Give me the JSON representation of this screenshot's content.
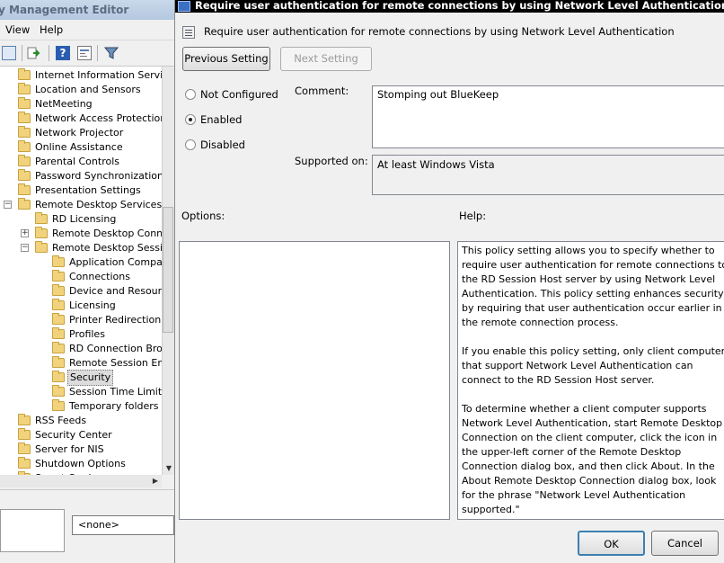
{
  "left_window": {
    "title": "y Management Editor",
    "menu": [
      "View",
      "Help"
    ],
    "tree": [
      {
        "label": "Internet Information Services",
        "level": 1
      },
      {
        "label": "Location and Sensors",
        "level": 1
      },
      {
        "label": "NetMeeting",
        "level": 1
      },
      {
        "label": "Network Access Protection",
        "level": 1
      },
      {
        "label": "Network Projector",
        "level": 1
      },
      {
        "label": "Online Assistance",
        "level": 1
      },
      {
        "label": "Parental Controls",
        "level": 1
      },
      {
        "label": "Password Synchronization",
        "level": 1
      },
      {
        "label": "Presentation Settings",
        "level": 1
      },
      {
        "label": "Remote Desktop Services",
        "level": 1,
        "expander": "−"
      },
      {
        "label": "RD Licensing",
        "level": 2
      },
      {
        "label": "Remote Desktop Connect",
        "level": 2,
        "expander": "+"
      },
      {
        "label": "Remote Desktop Session",
        "level": 2,
        "expander": "−"
      },
      {
        "label": "Application Compatibi",
        "level": 3
      },
      {
        "label": "Connections",
        "level": 3
      },
      {
        "label": "Device and Resource",
        "level": 3
      },
      {
        "label": "Licensing",
        "level": 3
      },
      {
        "label": "Printer Redirection",
        "level": 3
      },
      {
        "label": "Profiles",
        "level": 3
      },
      {
        "label": "RD Connection Broke",
        "level": 3
      },
      {
        "label": "Remote Session Envir",
        "level": 3
      },
      {
        "label": "Security",
        "level": 3,
        "selected": true
      },
      {
        "label": "Session Time Limits",
        "level": 3
      },
      {
        "label": "Temporary folders",
        "level": 3
      },
      {
        "label": "RSS Feeds",
        "level": 1
      },
      {
        "label": "Security Center",
        "level": 1
      },
      {
        "label": "Server for NIS",
        "level": 1
      },
      {
        "label": "Shutdown Options",
        "level": 1
      },
      {
        "label": "Smart Card",
        "level": 1
      }
    ],
    "filter_value": "<none>"
  },
  "dialog": {
    "title": "Require user authentication for remote connections by using Network Level Authentication",
    "header": "Require user authentication for remote connections by using Network Level Authentication",
    "prev_button": "Previous Setting",
    "next_button": "Next Setting",
    "radios": [
      {
        "label": "Not Configured",
        "checked": false
      },
      {
        "label": "Enabled",
        "checked": true
      },
      {
        "label": "Disabled",
        "checked": false
      }
    ],
    "comment_label": "Comment:",
    "comment_value": "Stomping out BlueKeep",
    "supported_label": "Supported on:",
    "supported_value": "At least Windows Vista",
    "options_label": "Options:",
    "help_label": "Help:",
    "help_text": "This policy setting allows you to specify whether to require user authentication for remote connections to the RD Session Host server by using Network Level Authentication. This policy setting enhances security by requiring that user authentication occur earlier in the remote connection process.\n\nIf you enable this policy setting, only client computers that support Network Level Authentication can connect to the RD Session Host server.\n\nTo determine whether a client computer supports Network Level Authentication, start Remote Desktop Connection on the client computer, click the icon in the upper-left corner of the Remote Desktop Connection dialog box, and then click About. In the About Remote Desktop Connection dialog box, look for the phrase \"Network Level Authentication supported.\"\n\nIf you disable or do not configure this policy setting, Network Level Authentication is not required for user authentication before allowing remote connections to the RD Session Host server.",
    "ok_button": "OK",
    "cancel_button": "Cancel"
  }
}
